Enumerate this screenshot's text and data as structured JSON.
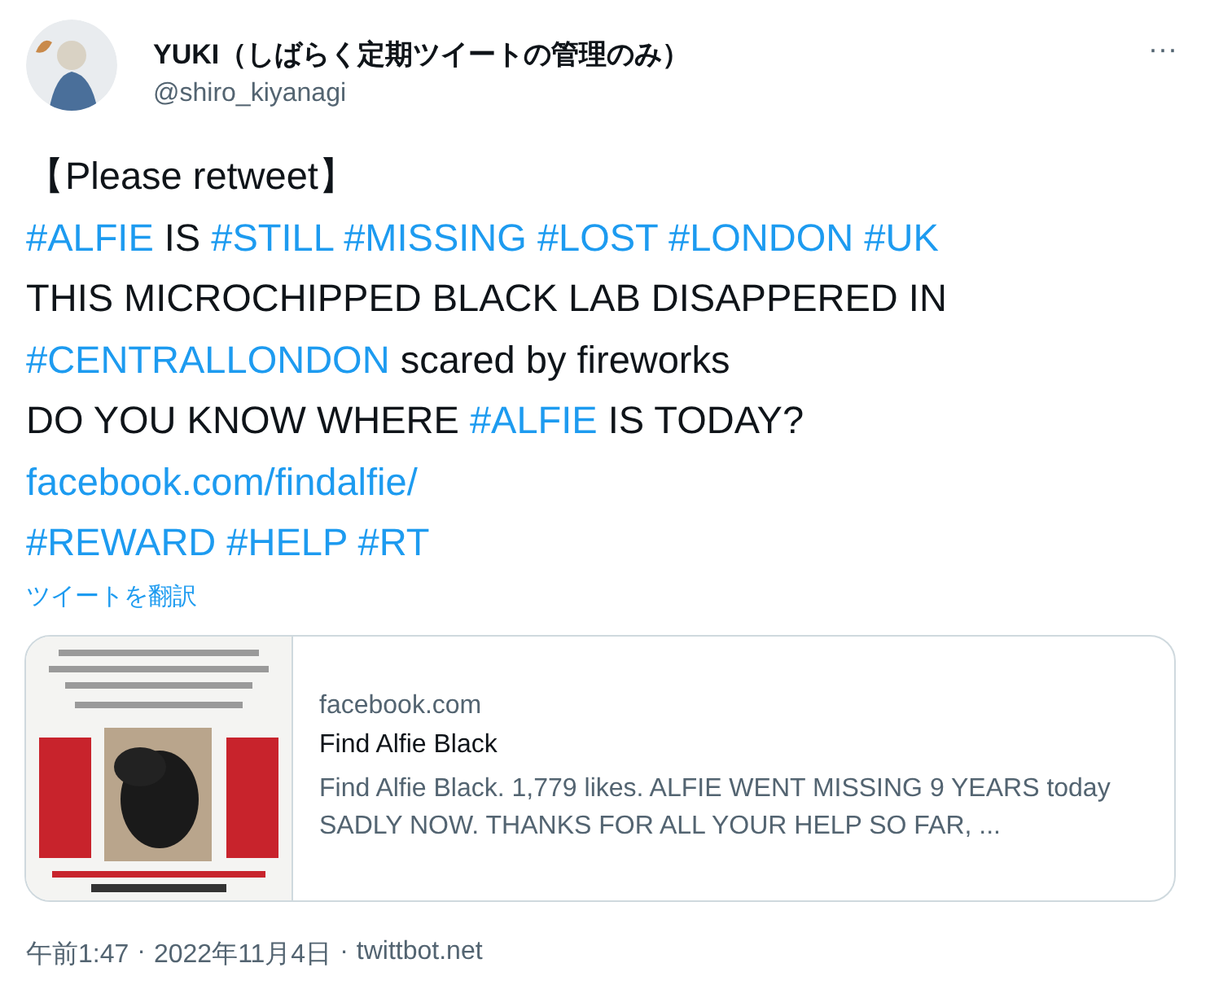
{
  "author": {
    "name": "YUKI（しばらく定期ツイートの管理のみ）",
    "handle": "@shiro_kiyanagi"
  },
  "more_button": "···",
  "body": [
    [
      {
        "kind": "text",
        "text": "【Please retweet】"
      }
    ],
    [
      {
        "kind": "hashtag",
        "text": "#ALFIE"
      },
      {
        "kind": "text",
        "text": "IS"
      },
      {
        "kind": "hashtag",
        "text": "#STILL"
      },
      {
        "kind": "hashtag",
        "text": "#MISSING"
      },
      {
        "kind": "hashtag",
        "text": "#LOST"
      },
      {
        "kind": "hashtag",
        "text": "#LONDON"
      },
      {
        "kind": "hashtag",
        "text": "#UK"
      }
    ],
    [
      {
        "kind": "text",
        "text": "THIS MICROCHIPPED BLACK LAB DISAPPERED IN"
      }
    ],
    [
      {
        "kind": "hashtag",
        "text": "#CENTRALLONDON"
      },
      {
        "kind": "text",
        "text": "scared by fireworks"
      }
    ],
    [
      {
        "kind": "text",
        "text": "DO YOU KNOW WHERE"
      },
      {
        "kind": "hashtag",
        "text": "#ALFIE"
      },
      {
        "kind": "text",
        "text": "IS TODAY?"
      }
    ],
    [
      {
        "kind": "link",
        "text": "facebook.com/findalfie/"
      }
    ],
    [
      {
        "kind": "hashtag",
        "text": "#REWARD"
      },
      {
        "kind": "hashtag",
        "text": "#HELP"
      },
      {
        "kind": "hashtag",
        "text": "#RT"
      }
    ]
  ],
  "translate_link": "ツイートを翻訳",
  "card": {
    "domain": "facebook.com",
    "title": "Find Alfie Black",
    "description": "Find Alfie Black. 1,779 likes. ALFIE WENT MISSING 9 YEARS today SADLY NOW. THANKS FOR ALL YOUR HELP SO FAR, ..."
  },
  "footer": {
    "time": "午前1:47",
    "date": "2022年11月4日",
    "source": "twittbot.net",
    "separator": "·"
  }
}
